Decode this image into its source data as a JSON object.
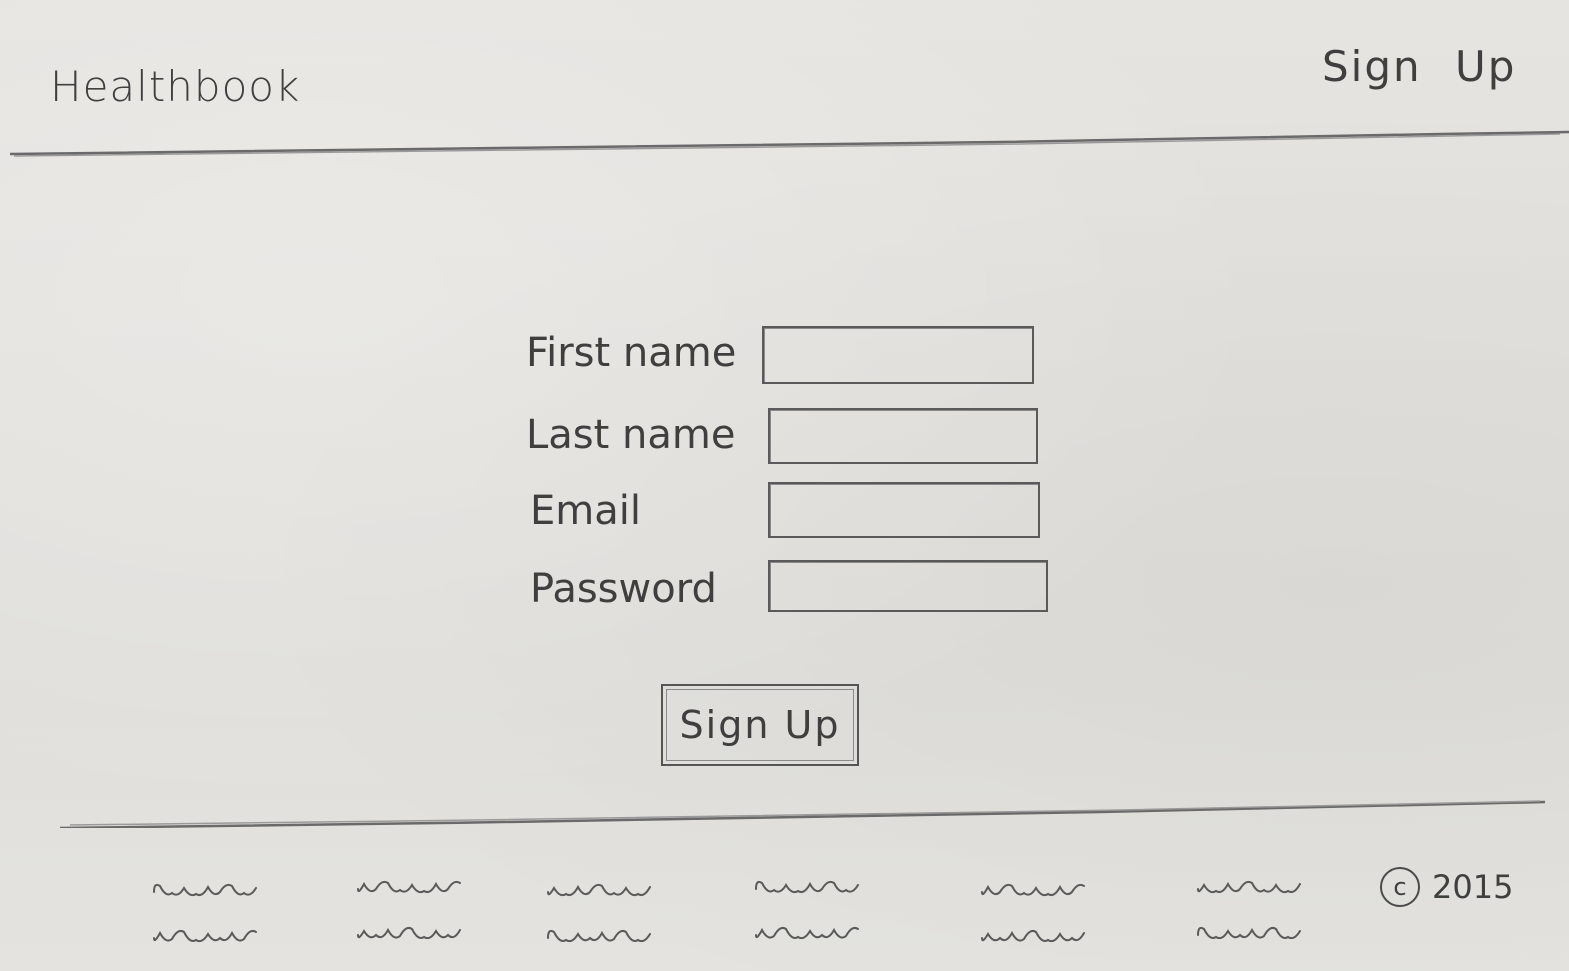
{
  "header": {
    "logo_text": "Healthbook",
    "signup_link": "Sign Up"
  },
  "form": {
    "fields": [
      {
        "label": "First name",
        "value": "",
        "placeholder": ""
      },
      {
        "label": "Last name",
        "value": "",
        "placeholder": ""
      },
      {
        "label": "Email",
        "value": "",
        "placeholder": ""
      },
      {
        "label": "Password",
        "value": "",
        "placeholder": ""
      }
    ],
    "submit_label": "Sign Up"
  },
  "footer": {
    "link_columns": 6,
    "links_per_column": 2,
    "copyright_symbol": "c",
    "copyright_year": "2015"
  },
  "colors": {
    "paper": "#e2e0dc",
    "pencil": "#4a4a4a"
  }
}
